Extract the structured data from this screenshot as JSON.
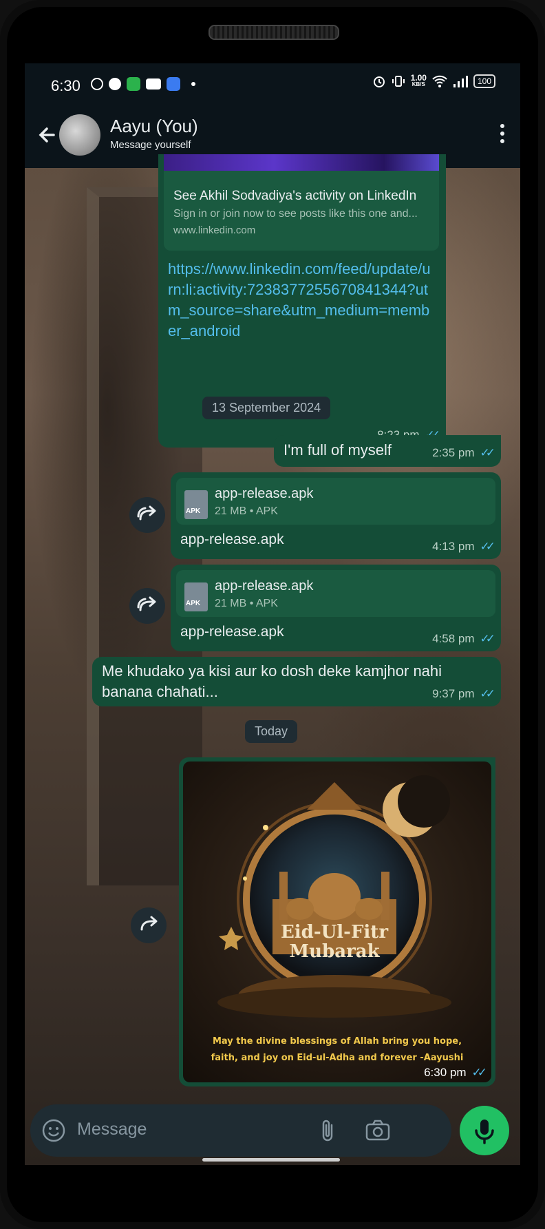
{
  "status_bar": {
    "time": "6:30",
    "speed_value": "1.00",
    "speed_unit": "KB/S",
    "battery": "100"
  },
  "header": {
    "name": "Aayu (You)",
    "subtitle": "Message yourself"
  },
  "messages": {
    "link_preview": {
      "title": "See Akhil Sodvadiya's activity on LinkedIn",
      "description": "Sign in or join now to see posts like this one and...",
      "site": "www.linkedin.com",
      "url": "https://www.linkedin.com/feed/update/urn:li:activity:7238377255670841344?utm_source=share&utm_medium=member_android",
      "time": "8:23 pm"
    },
    "date_1": "13 September 2024",
    "text_1": {
      "text": "I'm full of myself",
      "time": "2:35 pm"
    },
    "file_1": {
      "name": "app-release.apk",
      "meta": "21 MB • APK",
      "type": "APK",
      "caption": "app-release.apk",
      "time": "4:13 pm"
    },
    "file_2": {
      "name": "app-release.apk",
      "meta": "21 MB • APK",
      "type": "APK",
      "caption": "app-release.apk",
      "time": "4:58 pm"
    },
    "text_2": {
      "text": "Me khudako ya kisi aur ko dosh deke kamjhor nahi banana chahati...",
      "time": "9:37 pm"
    },
    "date_2": "Today",
    "image_1": {
      "title_1": "Eid-Ul-Fitr",
      "title_2": "Mubarak",
      "blessing_1": "May the divine blessings of Allah bring you hope,",
      "blessing_2": "faith, and joy on Eid-ul-Adha and forever -Aayushi",
      "time": "6:30 pm"
    }
  },
  "composer": {
    "placeholder": "Message"
  },
  "colors": {
    "accent": "#21c063",
    "outgoing_bubble": "#144d37",
    "link": "#53bdeb",
    "read_tick": "#53bdeb"
  }
}
